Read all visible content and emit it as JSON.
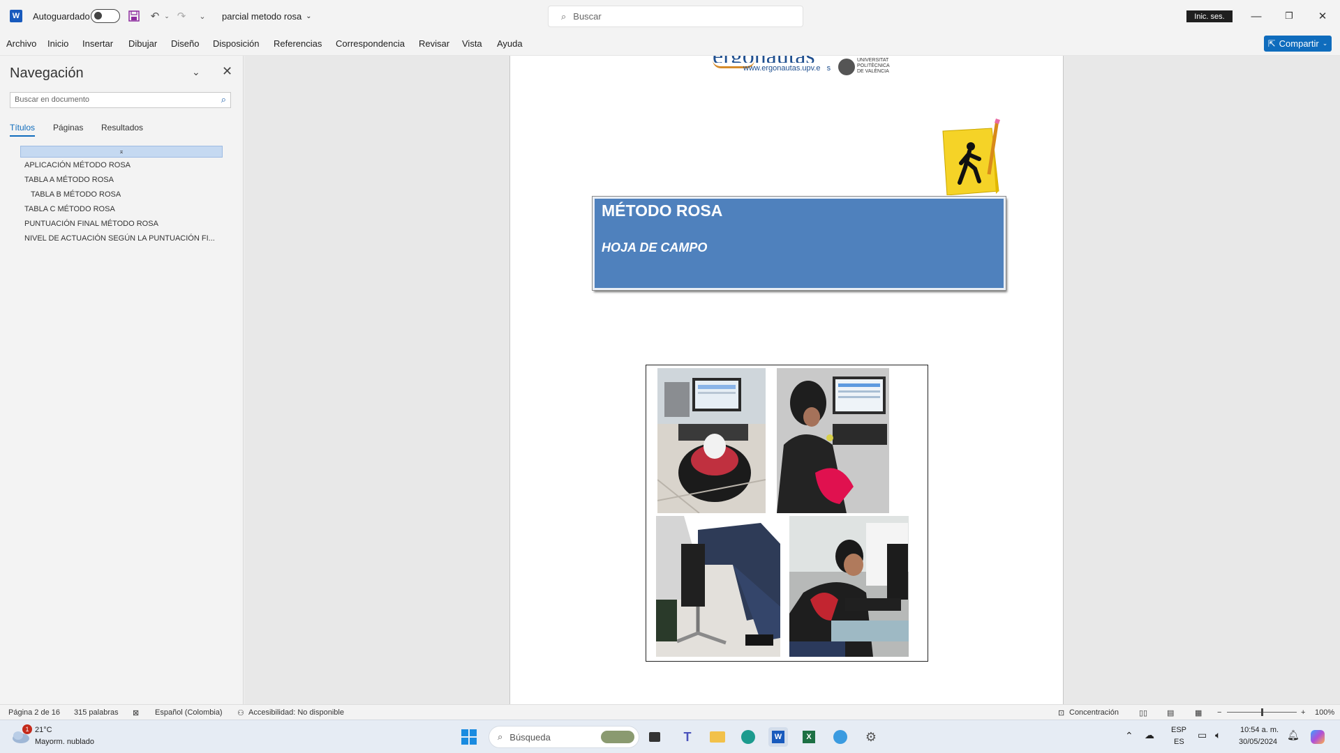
{
  "titlebar": {
    "app_icon": "word-icon",
    "autosave_label": "Autoguardado",
    "doc_title": "parcial metodo rosa",
    "search_placeholder": "Buscar",
    "signin": "Inic. ses."
  },
  "ribbon": {
    "tabs": [
      "Archivo",
      "Inicio",
      "Insertar",
      "Dibujar",
      "Diseño",
      "Disposición",
      "Referencias",
      "Correspondencia",
      "Revisar",
      "Vista",
      "Ayuda"
    ],
    "share": "Compartir"
  },
  "nav": {
    "title": "Navegación",
    "search_placeholder": "Buscar en documento",
    "tabs": [
      "Títulos",
      "Páginas",
      "Resultados"
    ],
    "headings": [
      "APLICACIÓN MÉTODO ROSA",
      "TABLA A MÉTODO ROSA",
      "TABLA B MÉTODO ROSA",
      "TABLA C MÉTODO ROSA",
      "PUNTUACIÓN FINAL MÉTODO ROSA",
      "NIVEL DE ACTUACIÓN SEGÚN LA PUNTUACIÓN FI..."
    ]
  },
  "document": {
    "logo_url": "www.ergonautas.upv.e",
    "logo_url_tail": "s",
    "logo_partial": "ergonautas",
    "univ_lines": [
      "UNIVERSITAT",
      "POLITÈCNICA",
      "DE VALÈNCIA"
    ],
    "title": "MÉTODO ROSA",
    "subtitle": "HOJA DE CAMPO"
  },
  "statusbar": {
    "page": "Página 2 de 16",
    "words": "315 palabras",
    "language": "Español (Colombia)",
    "accessibility": "Accesibilidad: No disponible",
    "focus": "Concentración",
    "zoom": "100%"
  },
  "taskbar": {
    "weather_temp": "21°C",
    "weather_desc": "Mayorm. nublado",
    "weather_badge": "1",
    "search": "Búsqueda",
    "lang_top": "ESP",
    "lang_bottom": "ES",
    "time": "10:54 a. m.",
    "date": "30/05/2024"
  }
}
